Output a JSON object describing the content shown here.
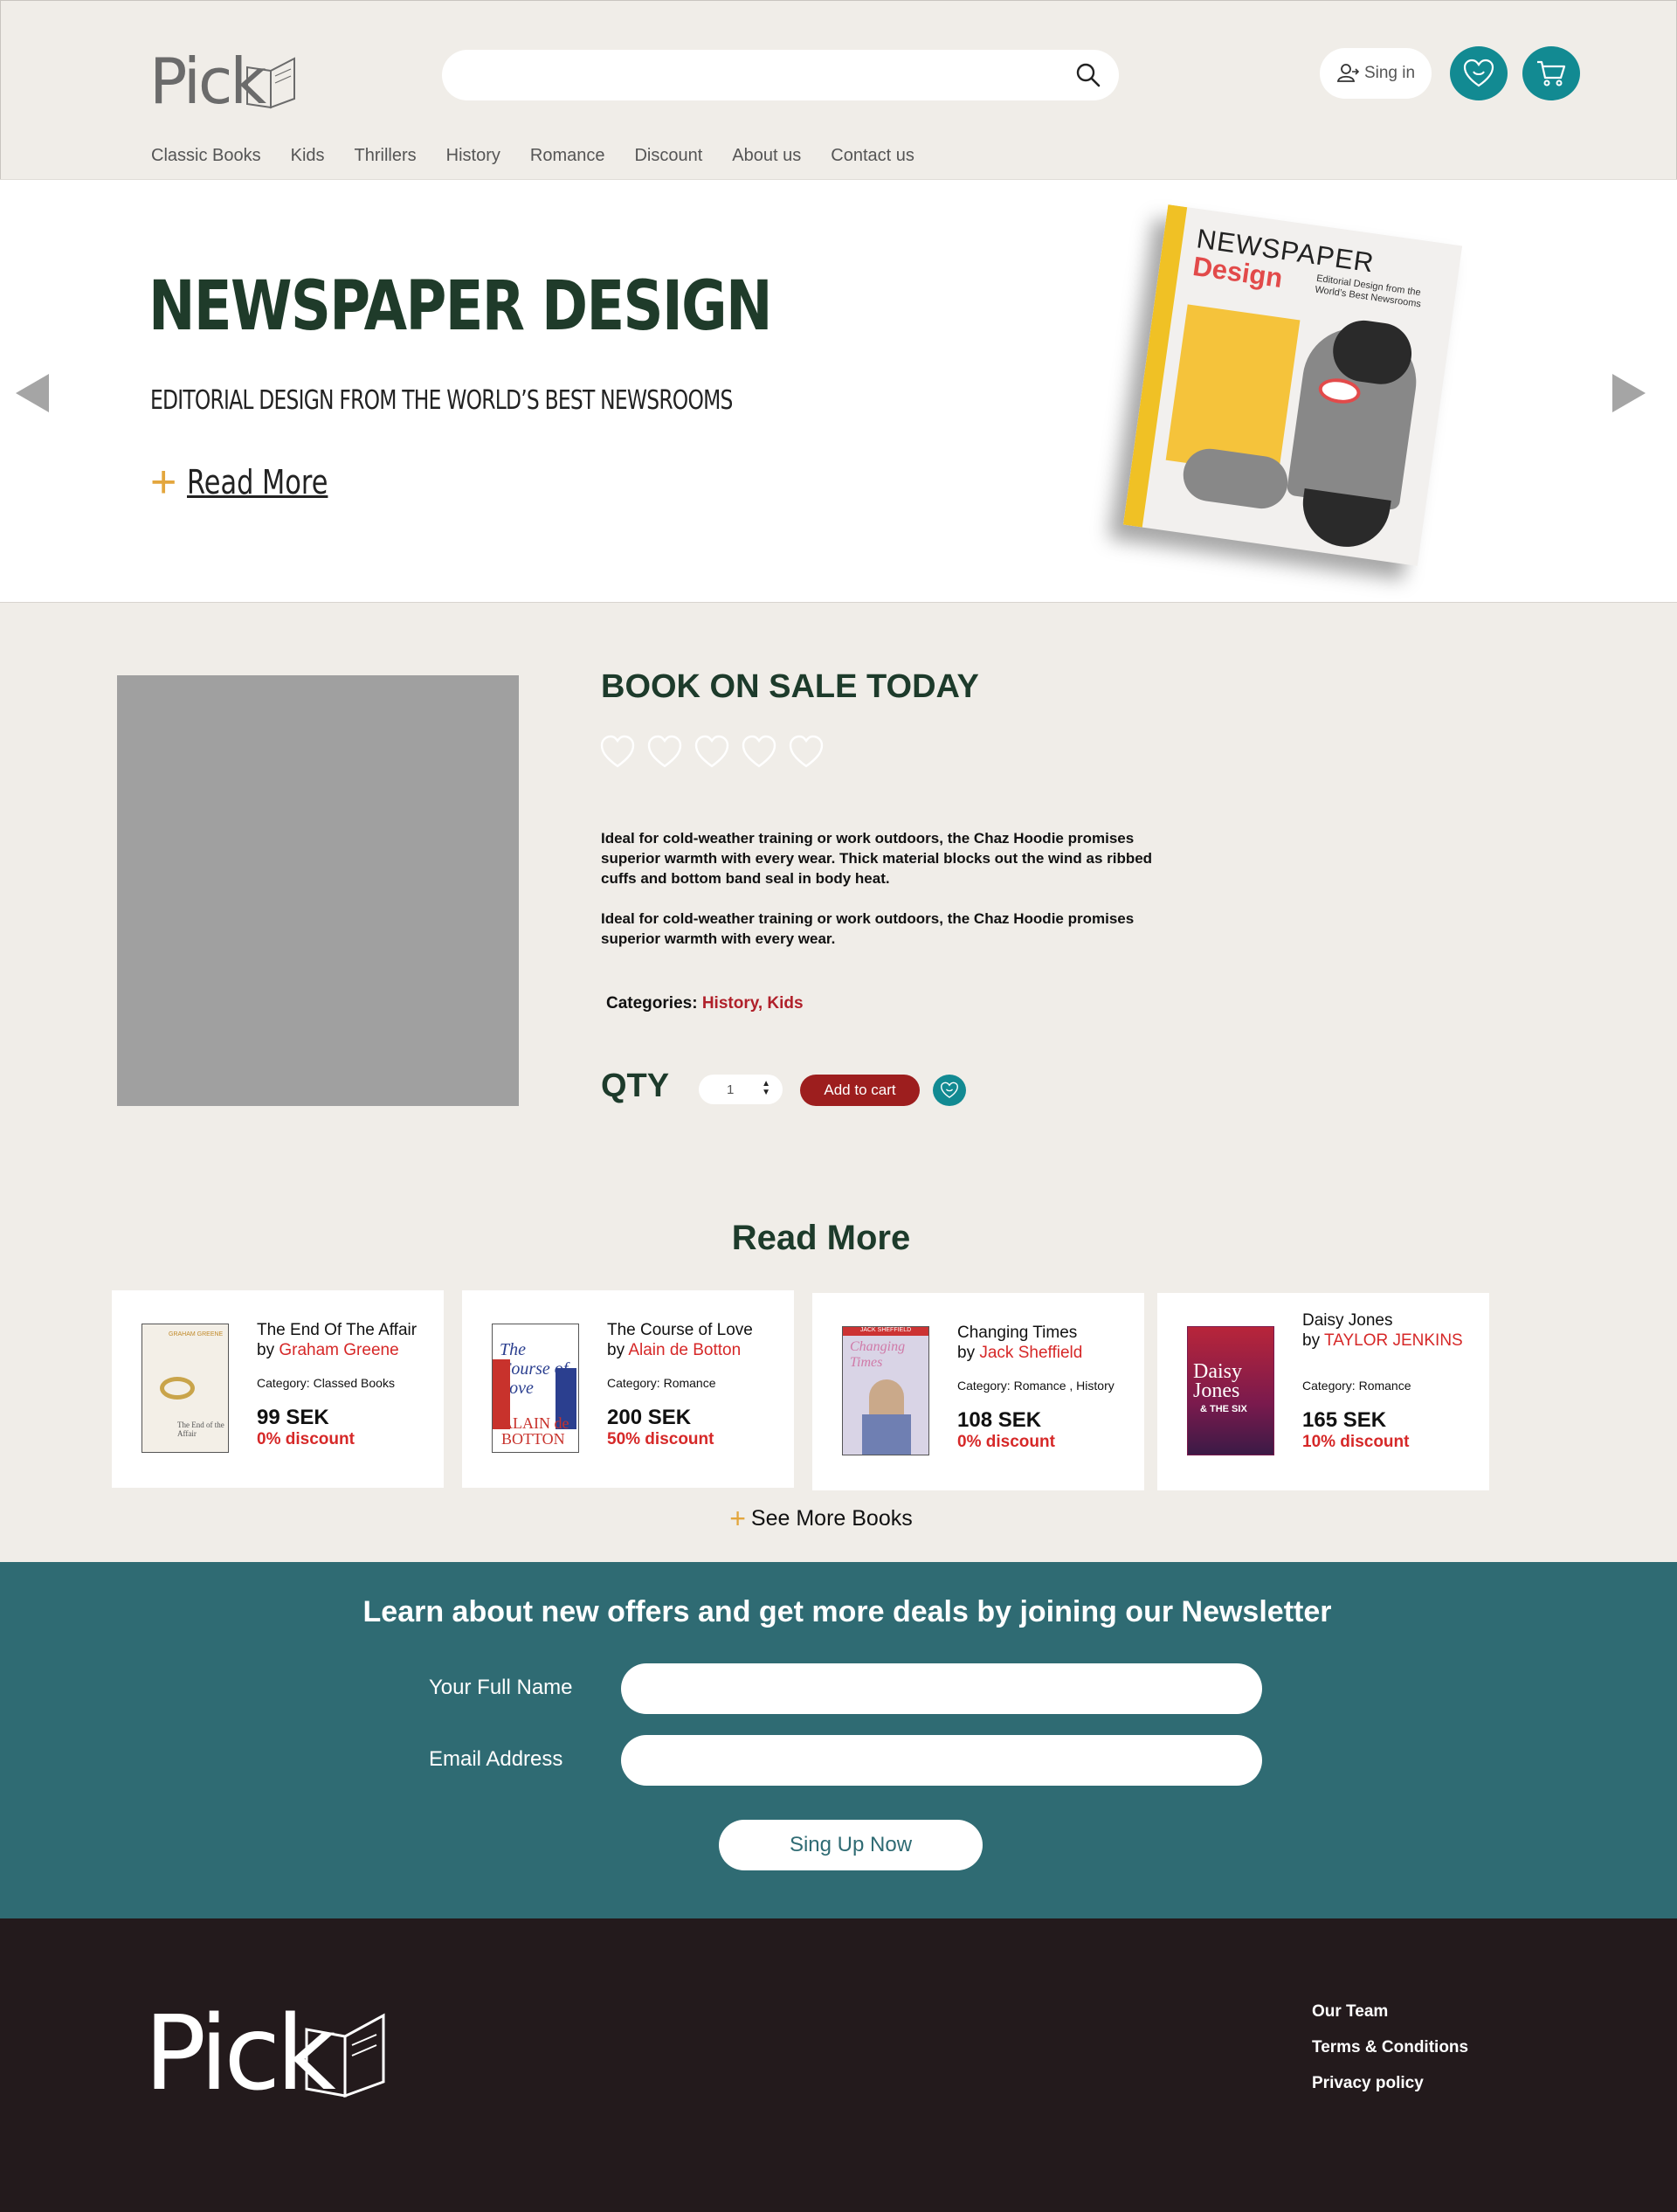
{
  "header": {
    "logo_text": "Pick",
    "search_placeholder": "",
    "signin_label": "Sing in"
  },
  "nav": [
    "Classic Books",
    "Kids",
    "Thrillers",
    "History",
    "Romance",
    "Discount",
    "About us",
    "Contact us"
  ],
  "hero": {
    "title": "NEWSPAPER DESIGN",
    "subtitle": "EDITORIAL DESIGN FROM THE WORLD’S BEST NEWSROOMS",
    "read_more": "Read More",
    "cover_title_1": "NEWSPAPER",
    "cover_title_2": "Design",
    "cover_subtitle": "Editorial Design from the World’s Best Newsrooms"
  },
  "product": {
    "title": "BOOK ON SALE TODAY",
    "rating": 0,
    "rating_max": 5,
    "desc_1": "Ideal for cold-weather training or work outdoors, the Chaz Hoodie promises superior warmth with every wear. Thick material blocks out the wind as ribbed cuffs and bottom band seal in body heat.",
    "desc_2": "Ideal for cold-weather training or work outdoors, the Chaz Hoodie promises superior warmth with every wear.",
    "categories_label": "Categories:",
    "categories_value": "History, Kids",
    "qty_label": "QTY",
    "qty_value": "1",
    "add_to_cart": "Add to cart"
  },
  "read_more": {
    "title": "Read More",
    "see_more": "See More Books",
    "books": [
      {
        "title": "The End Of The Affair",
        "by": "by ",
        "author": "Graham Greene",
        "category": "Category: Classed Books",
        "price": "99 SEK",
        "discount": "0% discount"
      },
      {
        "title": "The Course of Love",
        "by": "by ",
        "author": "Alain de Botton",
        "category": "Category: Romance",
        "price": "200 SEK",
        "discount": "50% discount"
      },
      {
        "title": "Changing Times",
        "by": "by ",
        "author": "Jack Sheffield",
        "category": "Category: Romance , History",
        "price": "108 SEK",
        "discount": "0% discount"
      },
      {
        "title": "Daisy Jones",
        "by": "by ",
        "author": "TAYLOR JENKINS",
        "category": "Category: Romance",
        "price": "165 SEK",
        "discount": "10% discount"
      }
    ]
  },
  "newsletter": {
    "title": "Learn about new offers and get more deals by joining our Newsletter",
    "name_label": "Your Full Name",
    "email_label": "Email Address",
    "button": "Sing Up Now"
  },
  "footer": {
    "logo_text": "Pick",
    "links": [
      "Our Team",
      "Terms & Conditions",
      "Privacy policy"
    ]
  },
  "colors": {
    "teal": "#128a92",
    "newsletter_bg": "#2f6b73",
    "footer_bg": "#231a1c",
    "accent_red": "#d62828",
    "cart_red": "#9d1e1e",
    "dark_green": "#1d3b2b",
    "plus_yellow": "#e3a63d"
  },
  "icons": [
    "search-icon",
    "user-icon",
    "heart-smile-icon",
    "cart-icon",
    "arrow-left-icon",
    "arrow-right-icon",
    "heart-outline-icon",
    "plus-icon"
  ]
}
